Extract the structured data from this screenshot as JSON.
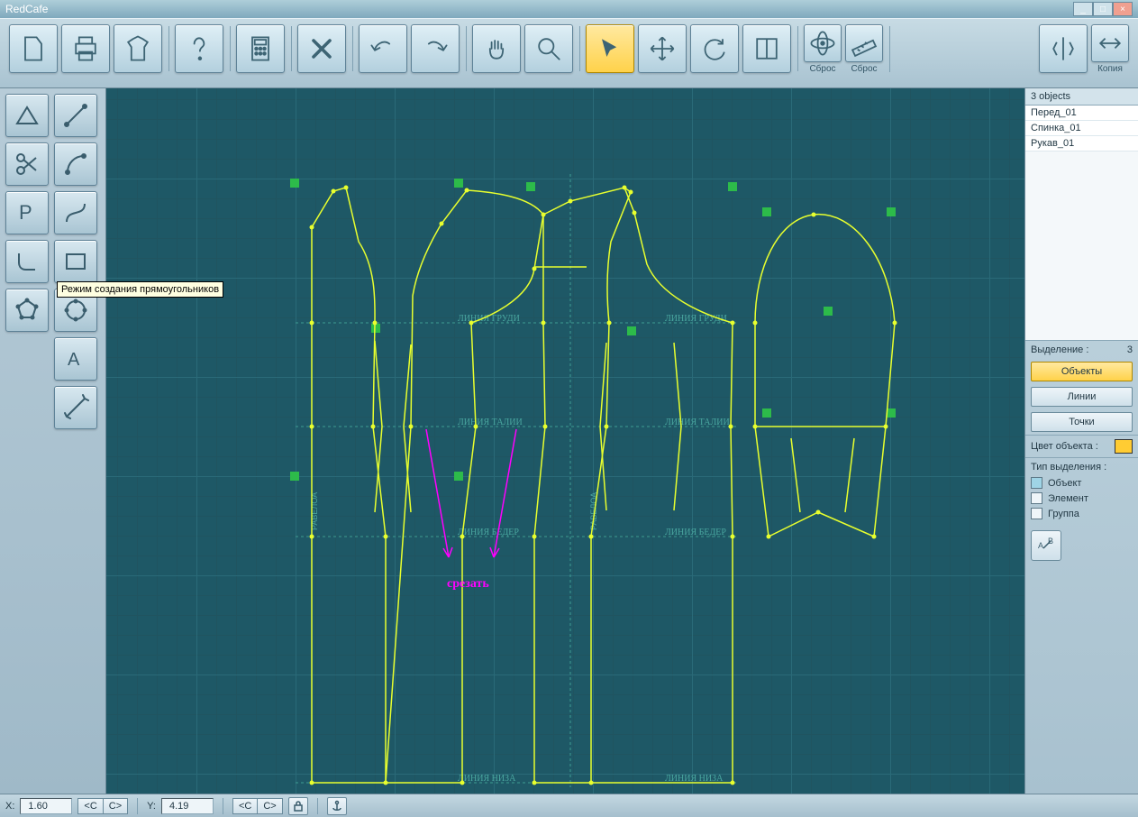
{
  "app": {
    "title": "RedCafe"
  },
  "toolbar": {
    "reset_label": "Сброс",
    "copy_label": "Копия"
  },
  "tooltip": {
    "rectangle_mode": "Режим создания прямоугольников"
  },
  "canvas": {
    "guide_chest": "ЛИНИЯ  ГРУДИ",
    "guide_waist": "ЛИНИЯ  ТАЛИИ",
    "guide_hip": "ЛИНИЯ  БЕДЕР",
    "guide_bottom": "ЛИНИЯ  НИЗА",
    "balance": "РАВЕЛОА",
    "cut_label": "срезать"
  },
  "right": {
    "header": "3 objects",
    "items": [
      "Перед_01",
      "Спинка_01",
      "Рукав_01"
    ],
    "selection_label": "Выделение :",
    "selection_count": "3",
    "btn_objects": "Объекты",
    "btn_lines": "Линии",
    "btn_points": "Точки",
    "color_label": "Цвет объекта :",
    "color_value": "#ffcc33",
    "seltype_label": "Тип выделения :",
    "sel_object": "Объект",
    "sel_element": "Элемент",
    "sel_group": "Группа"
  },
  "status": {
    "x_label": "X:",
    "x_value": "1.60",
    "y_label": "Y:",
    "y_value": "4.19",
    "btn_left": "<C",
    "btn_right": "C>"
  }
}
